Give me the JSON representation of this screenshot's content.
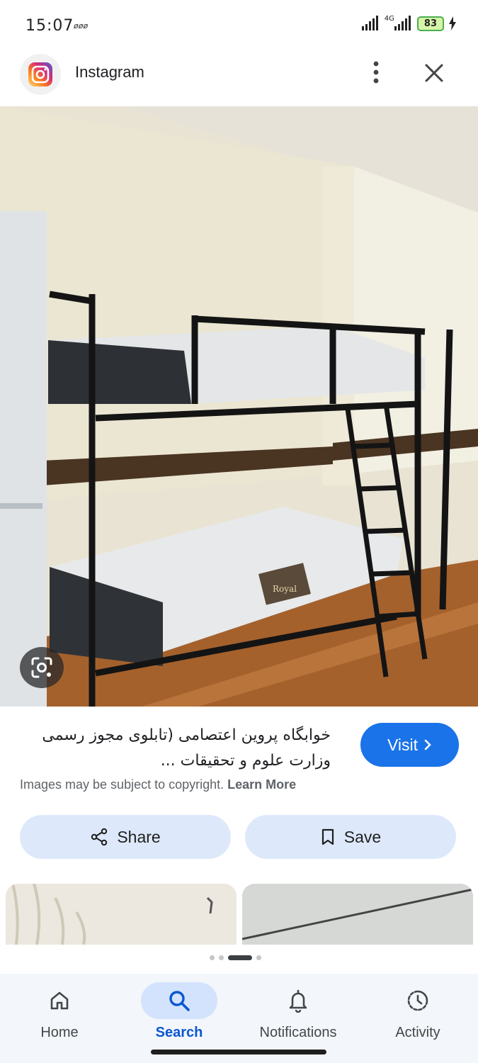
{
  "status_bar": {
    "time": "15:07",
    "extra": "øøø",
    "network": "4G",
    "battery": "83"
  },
  "app": {
    "name": "Instagram"
  },
  "result": {
    "title": "خوابگاه پروین اعتصامی (تابلوی مجوز رسمی وزارت علوم و تحقیقات ...",
    "visit_label": "Visit",
    "copyright_text": "Images may be subject to copyright.",
    "learn_more": "Learn More"
  },
  "actions": {
    "share_label": "Share",
    "save_label": "Save"
  },
  "image_text": {
    "mattress_brand": "Royal"
  },
  "nav": {
    "items": [
      {
        "label": "Home",
        "icon": "home-icon"
      },
      {
        "label": "Search",
        "icon": "search-icon"
      },
      {
        "label": "Notifications",
        "icon": "bell-icon"
      },
      {
        "label": "Activity",
        "icon": "activity-icon"
      }
    ],
    "active": "Search"
  },
  "colors": {
    "accent": "#1a73e8",
    "pill_bg": "#dde9fb",
    "nav_active_bg": "#d3e3fd",
    "battery_bg": "#d6f5a8"
  }
}
